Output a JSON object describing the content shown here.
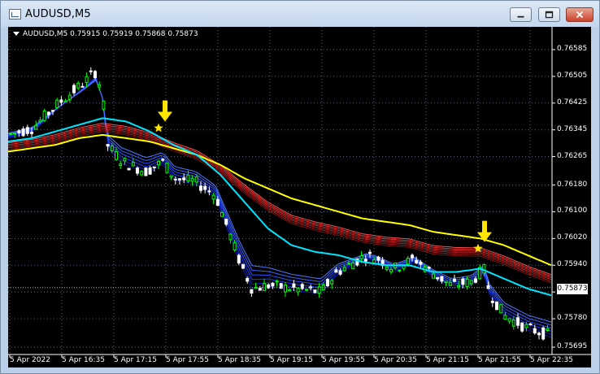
{
  "window": {
    "title": "AUDUSD,M5"
  },
  "chart": {
    "symbol_info": "AUDUSD,M5  0.75915 0.75919 0.75868 0.75873",
    "current_price": "0.75873",
    "colors": {
      "background": "#000000",
      "bull": "#00ff00",
      "bear": "#ffffff",
      "fast_ema": "#00e5ff",
      "slow_ema": "#ffff00",
      "blue_ribbon": "#1a3cff",
      "red_ribbon": "#ff2a2a",
      "signal_arrow": "#ffe600",
      "grid": "#5a6a7a"
    },
    "icons": {
      "signal": "down-arrow-icon",
      "marker": "star-icon"
    }
  },
  "chart_data": {
    "type": "candlestick",
    "title": "AUDUSD,M5",
    "ohlc_last": {
      "open": 0.75915,
      "high": 0.75919,
      "low": 0.75868,
      "close": 0.75873
    },
    "ylim": [
      0.7568,
      0.7667
    ],
    "yticks": [
      "0.76585",
      "0.76505",
      "0.76425",
      "0.76345",
      "0.76265",
      "0.76180",
      "0.76100",
      "0.76020",
      "0.75940",
      "0.75860",
      "0.75780",
      "0.75695"
    ],
    "ytick_values": [
      0.76585,
      0.76505,
      0.76425,
      0.76345,
      0.76265,
      0.7618,
      0.761,
      0.7602,
      0.7594,
      0.7586,
      0.7578,
      0.75695
    ],
    "xticks": [
      "5 Apr 2022",
      "5 Apr 16:35",
      "5 Apr 17:15",
      "5 Apr 17:55",
      "5 Apr 18:35",
      "5 Apr 19:15",
      "5 Apr 19:55",
      "5 Apr 20:35",
      "5 Apr 21:15",
      "5 Apr 21:55",
      "5 Apr 22:35"
    ],
    "grid": true,
    "series": [
      {
        "name": "fast_ema",
        "values": [
          0.7631,
          0.7632,
          0.7634,
          0.7636,
          0.7638,
          0.7637,
          0.7634,
          0.763,
          0.7627,
          0.7621,
          0.7613,
          0.7605,
          0.76,
          0.7598,
          0.7597,
          0.7595,
          0.7594,
          0.7594,
          0.7592,
          0.7592,
          0.7593,
          0.759,
          0.7587,
          0.7585
        ]
      },
      {
        "name": "slow_ema",
        "values": [
          0.7628,
          0.7629,
          0.763,
          0.7632,
          0.7633,
          0.7632,
          0.7631,
          0.7629,
          0.7627,
          0.7624,
          0.762,
          0.7617,
          0.7614,
          0.7612,
          0.761,
          0.7608,
          0.7607,
          0.7606,
          0.7604,
          0.7603,
          0.7602,
          0.76,
          0.7597,
          0.7594
        ]
      }
    ],
    "signals": [
      {
        "time": "5 Apr 17:35",
        "type": "sell",
        "price": 0.7634
      },
      {
        "time": "5 Apr 21:55",
        "type": "sell",
        "price": 0.7599
      }
    ]
  }
}
